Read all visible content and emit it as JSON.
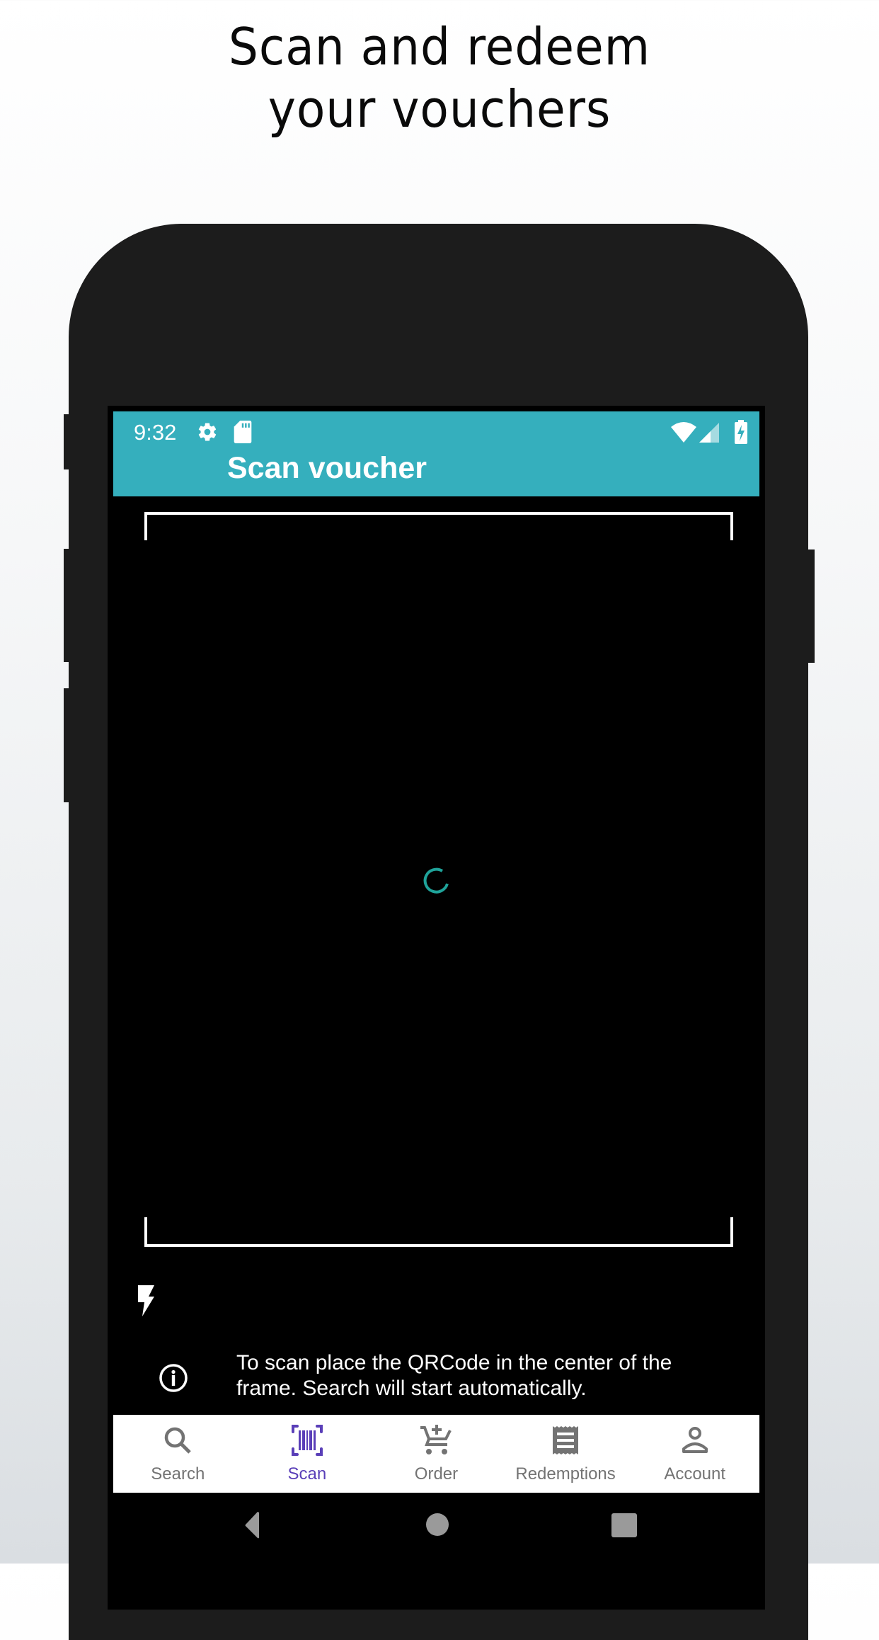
{
  "promo": {
    "title_line1": "Scan and redeem",
    "title_line2": "your vouchers"
  },
  "status_bar": {
    "time": "9:32",
    "icons": [
      "gear-icon",
      "sd-card-icon",
      "wifi-icon",
      "signal-icon",
      "battery-charging-icon"
    ]
  },
  "appbar": {
    "title": "Scan voucher"
  },
  "scanner": {
    "state": "loading",
    "flash_icon": "flash-icon",
    "hint": "To scan place the QRCode in the center of the frame. Search will start automatically."
  },
  "bottom_nav": {
    "active": "Scan",
    "items": [
      {
        "label": "Search",
        "icon": "search-icon"
      },
      {
        "label": "Scan",
        "icon": "barcode-scan-icon"
      },
      {
        "label": "Order",
        "icon": "cart-add-icon"
      },
      {
        "label": "Redemptions",
        "icon": "receipt-icon"
      },
      {
        "label": "Account",
        "icon": "account-icon"
      }
    ]
  },
  "system_nav": {
    "buttons": [
      "back",
      "home",
      "recents"
    ]
  },
  "colors": {
    "appbar": "#35afbd",
    "active_nav": "#5a3fb8",
    "inactive_nav": "#737373",
    "spinner": "#1fa39a"
  }
}
